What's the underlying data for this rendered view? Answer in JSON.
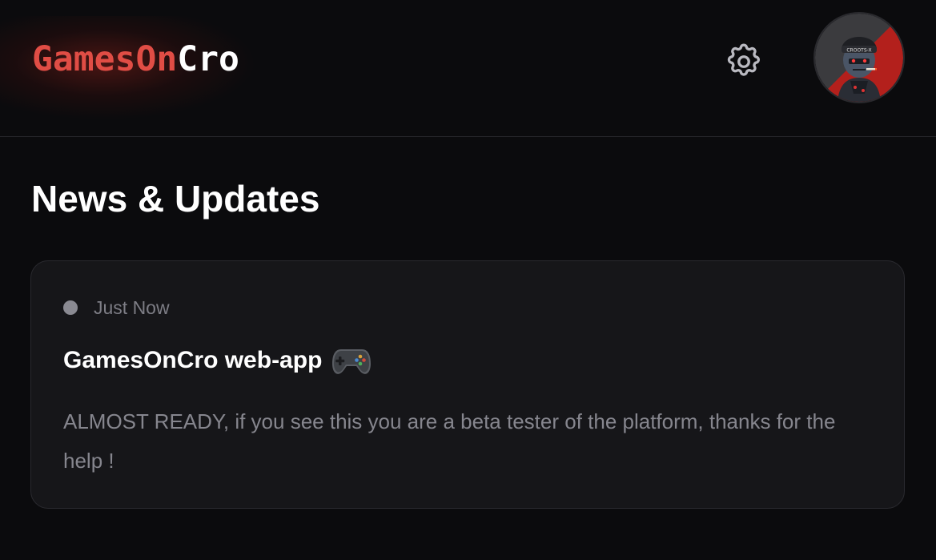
{
  "header": {
    "logo_accent": "GamesOn",
    "logo_rest": "Cro",
    "settings_icon": "gear-icon",
    "avatar_icon": "user-avatar"
  },
  "page": {
    "title": "News & Updates"
  },
  "news": [
    {
      "time": "Just Now",
      "title": "GamesOnCro web-app",
      "emoji_icon": "gamepad-icon",
      "body": "ALMOST READY, if you see this you are a beta tester of the platform, thanks for the help !"
    }
  ],
  "colors": {
    "background": "#0b0b0d",
    "accent": "#e04d45",
    "card": "#161619",
    "muted_text": "#86868e"
  }
}
